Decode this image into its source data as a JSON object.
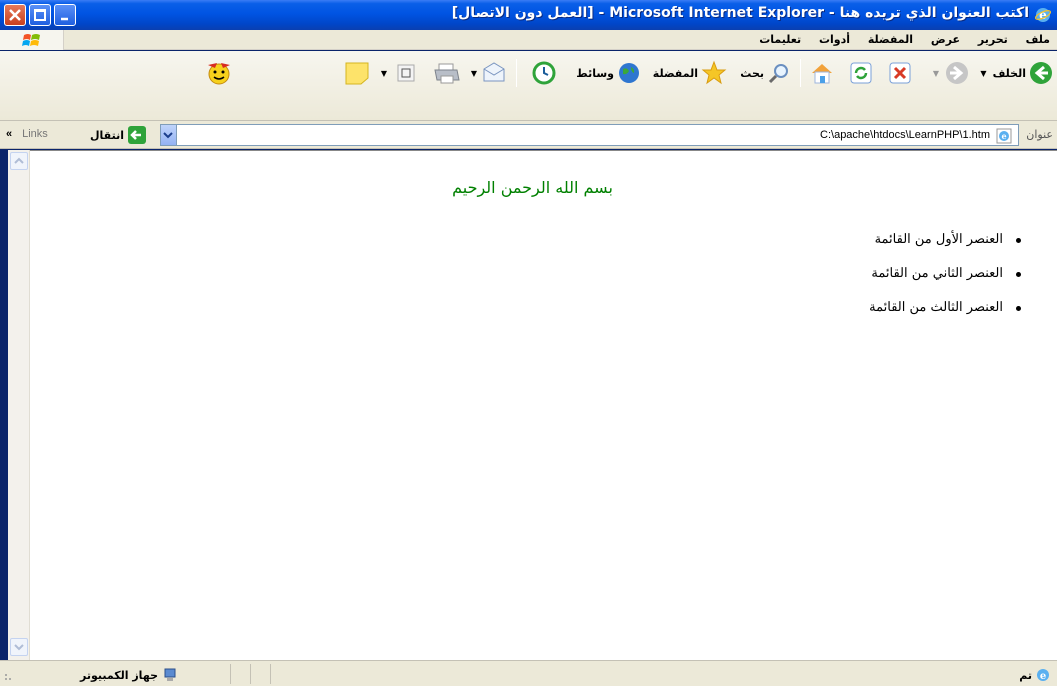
{
  "window": {
    "title": "اكتب العنوان الذي تريده هنا - Microsoft Internet Explorer - [العمل دون الاتصال]"
  },
  "menu": {
    "items": [
      "ملف",
      "تحرير",
      "عرض",
      "المفضلة",
      "أدوات",
      "تعليمات"
    ]
  },
  "toolbar": {
    "back_label": "الخلف",
    "search_label": "بحث",
    "favorites_label": "المفضلة",
    "media_label": "وسائط"
  },
  "address": {
    "label": "عنوان",
    "value": "C:\\apache\\htdocs\\LearnPHP\\1.htm",
    "go_label": "انتقال",
    "links_label": "Links"
  },
  "page": {
    "title": "بسم الله الرحمن الرحيم",
    "list_items": [
      "العنصر الأول من القائمة",
      "العنصر الثاني من القائمة",
      "العنصر الثالث من القائمة"
    ]
  },
  "status": {
    "done": "تم",
    "zone": "جهاز الكمبيوتر"
  },
  "colors": {
    "title_bar": "#0054e3",
    "page_title": "#008000",
    "chrome": "#ece9d8"
  }
}
